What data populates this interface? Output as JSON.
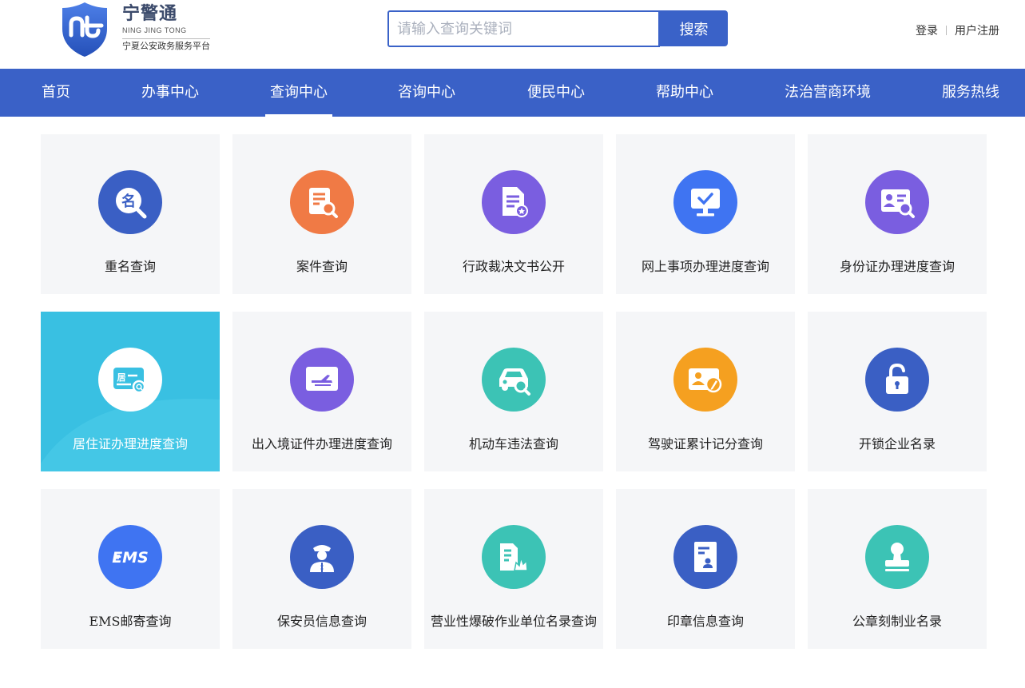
{
  "header": {
    "logo": {
      "name_cn": "宁警通",
      "name_pinyin": "NING JING TONG",
      "subtitle": "宁夏公安政务服务平台"
    },
    "search": {
      "placeholder": "请输入查询关键词",
      "value": "",
      "button_label": "搜索"
    },
    "auth": {
      "login_label": "登录",
      "register_label": "用户注册"
    }
  },
  "nav": {
    "items": [
      {
        "label": "首页"
      },
      {
        "label": "办事中心"
      },
      {
        "label": "查询中心",
        "active": true
      },
      {
        "label": "咨询中心"
      },
      {
        "label": "便民中心"
      },
      {
        "label": "帮助中心"
      },
      {
        "label": "法治营商环境"
      },
      {
        "label": "服务热线"
      }
    ]
  },
  "colors": {
    "brand": "#3a61c7",
    "active_tile": "#39c0e2",
    "tile_bg": "#f5f6f8"
  },
  "services": [
    {
      "label": "重名查询",
      "icon": "name-search-icon",
      "color": "#3a5fc4"
    },
    {
      "label": "案件查询",
      "icon": "case-search-icon",
      "color": "#f07a45"
    },
    {
      "label": "行政裁决文书公开",
      "icon": "document-icon",
      "color": "#7a5ee0"
    },
    {
      "label": "网上事项办理进度查询",
      "icon": "monitor-check-icon",
      "color": "#3f74f2"
    },
    {
      "label": "身份证办理进度查询",
      "icon": "id-card-search-icon",
      "color": "#7a5ee0"
    },
    {
      "label": "居住证办理进度查询",
      "icon": "residence-card-icon",
      "color": "#ffffff",
      "active": true,
      "icon_text": "居"
    },
    {
      "label": "出入境证件办理进度查询",
      "icon": "airplane-card-icon",
      "color": "#7a5ee0"
    },
    {
      "label": "机动车违法查询",
      "icon": "car-search-icon",
      "color": "#3cc3b5"
    },
    {
      "label": "驾驶证累计记分查询",
      "icon": "license-pen-icon",
      "color": "#f5a020"
    },
    {
      "label": "开锁企业名录",
      "icon": "unlock-icon",
      "color": "#3a5fc4"
    },
    {
      "label": "EMS邮寄查询",
      "icon": "ems-icon",
      "color": "#3f74f2",
      "icon_text": "EMS"
    },
    {
      "label": "保安员信息查询",
      "icon": "security-guard-icon",
      "color": "#3a5fc4"
    },
    {
      "label": "营业性爆破作业单位名录查询",
      "icon": "explosion-building-icon",
      "color": "#3cc3b5"
    },
    {
      "label": "印章信息查询",
      "icon": "seal-document-icon",
      "color": "#3a5fc4"
    },
    {
      "label": "公章刻制业名录",
      "icon": "stamp-icon",
      "color": "#3cc3b5"
    }
  ]
}
